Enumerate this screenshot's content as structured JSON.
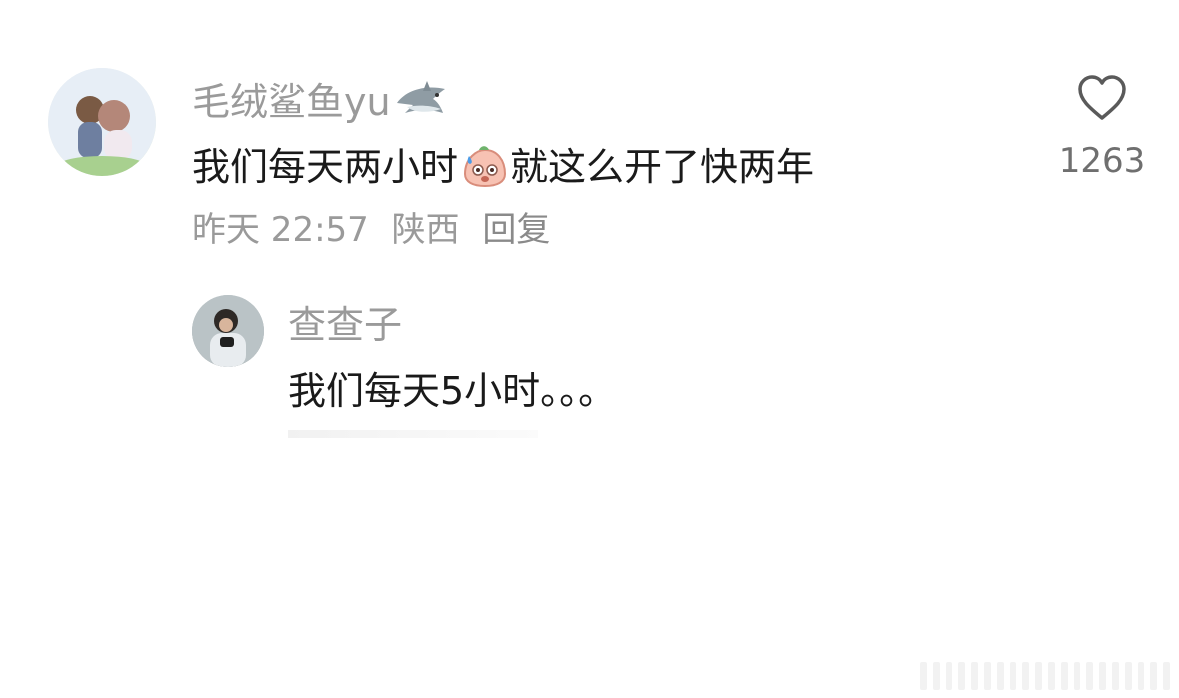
{
  "comment": {
    "username": "毛绒鲨鱼yu",
    "badge_icon": "shark-icon",
    "text_before_emoji": "我们每天两小时",
    "emoji_icon": "sweating-face-emoji-icon",
    "text_after_emoji": "就这么开了快两年",
    "time": "昨天 22:57",
    "location": "陕西",
    "reply_label": "回复",
    "like_icon": "heart-icon",
    "like_count": "1263"
  },
  "reply": {
    "username": "查查子",
    "text": "我们每天5小时。。。"
  }
}
